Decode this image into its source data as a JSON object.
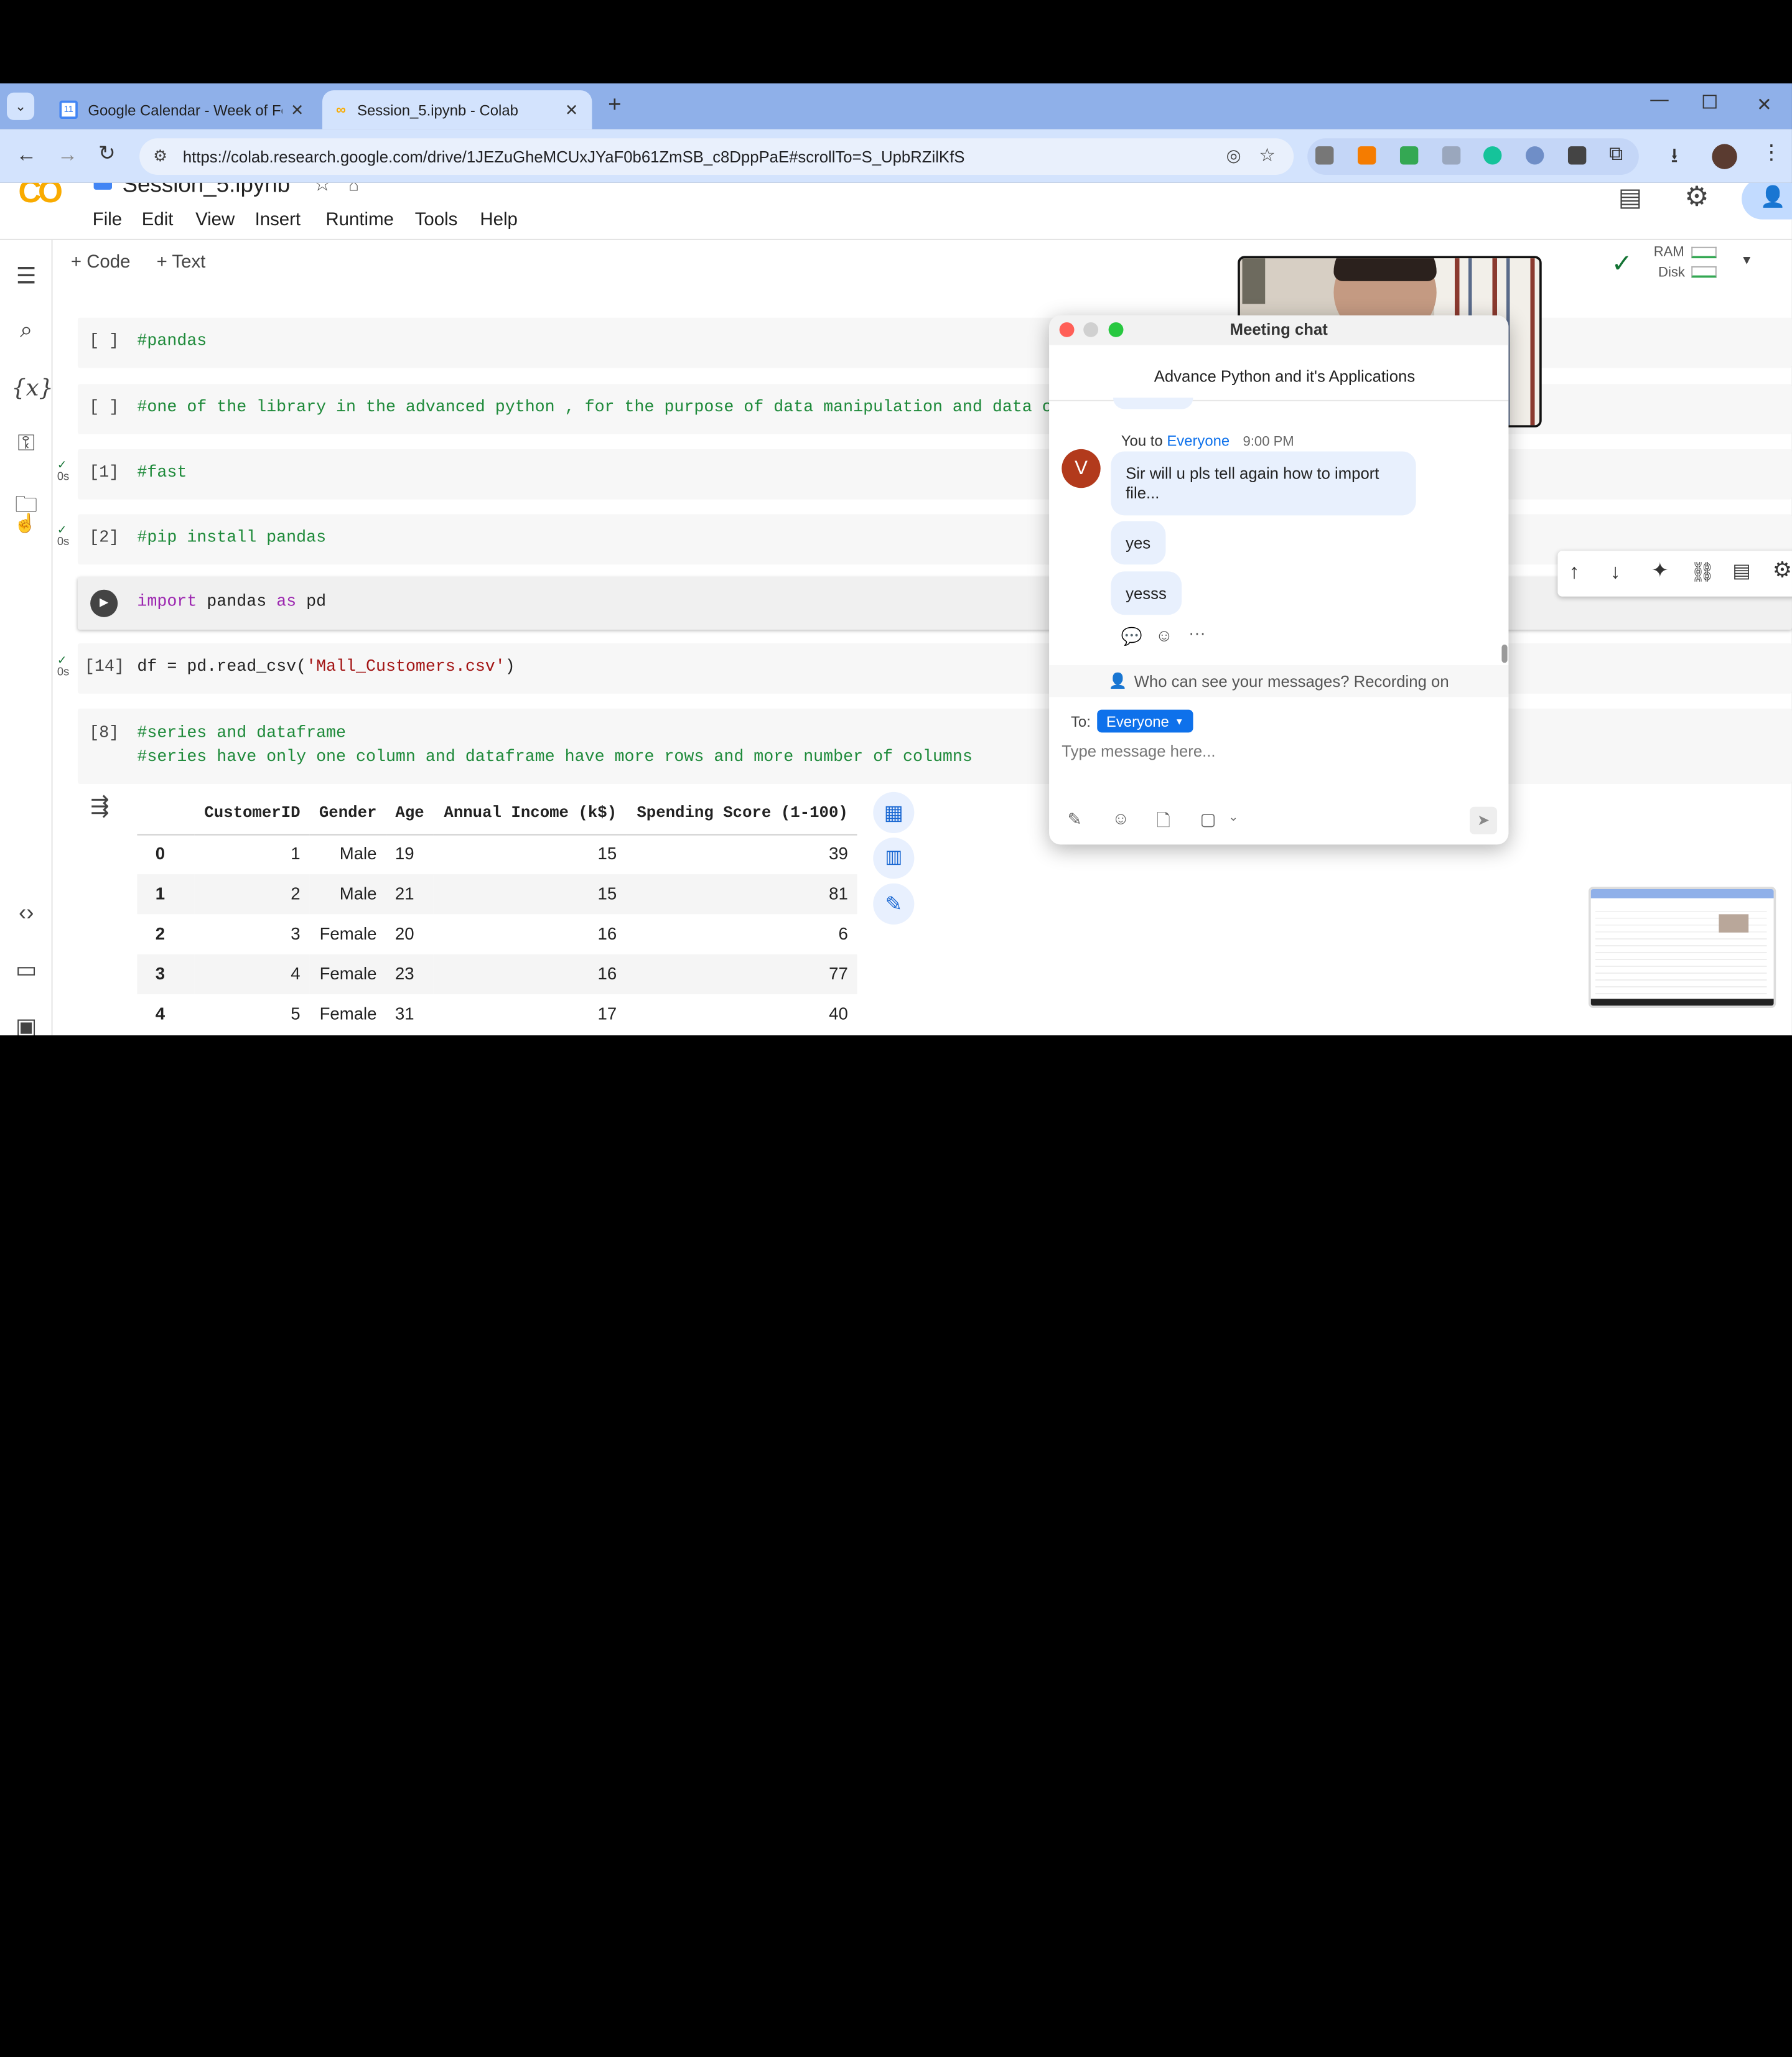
{
  "browser": {
    "tabs": [
      {
        "label": "Google Calendar - Week of Feb",
        "favicon": "calendar-icon"
      },
      {
        "label": "Session_5.ipynb - Colab",
        "favicon": "colab-icon"
      }
    ],
    "calendar_favicon_text": "11",
    "url": "https://colab.research.google.com/drive/1JEZuGheMCUxJYaF0b61ZmSB_c8DppPaE#scrollTo=S_UpbRZilKfS"
  },
  "colab": {
    "logo": "CO",
    "notebook_title": "Session_5.ipynb",
    "menu": [
      "File",
      "Edit",
      "View",
      "Insert",
      "Runtime",
      "Tools",
      "Help"
    ],
    "toolbar": {
      "code_label": "+ Code",
      "text_label": "+ Text"
    },
    "resources": {
      "ram_label": "RAM",
      "disk_label": "Disk"
    },
    "cells": [
      {
        "exec": "[ ]",
        "code": "#pandas"
      },
      {
        "exec": "[ ]",
        "code": "#one of the library in the advanced python , for the purpose of data manipulation and data cl"
      },
      {
        "exec": "[1]",
        "code": "#fast",
        "time": "0s"
      },
      {
        "exec": "[2]",
        "code": "#pip install pandas",
        "time": "0s"
      },
      {
        "exec": "",
        "code_kw1": "import",
        "code_mid": " pandas ",
        "code_kw2": "as",
        "code_end": " pd"
      },
      {
        "exec": "[14]",
        "code_pre": "df = pd.read_csv(",
        "code_str": "'Mall_Customers.csv'",
        "code_post": ")",
        "time": "0s"
      },
      {
        "exec": "[8]",
        "line1": "#series and dataframe",
        "line2": "#series have only one column and dataframe have more rows and more number of columns"
      }
    ],
    "table": {
      "columns": [
        "",
        "CustomerID",
        "Gender",
        "Age",
        "Annual Income (k$)",
        "Spending Score (1-100)"
      ],
      "rows": [
        [
          "0",
          "1",
          "Male",
          "19",
          "15",
          "39"
        ],
        [
          "1",
          "2",
          "Male",
          "21",
          "15",
          "81"
        ],
        [
          "2",
          "3",
          "Female",
          "20",
          "16",
          "6"
        ],
        [
          "3",
          "4",
          "Female",
          "23",
          "16",
          "77"
        ],
        [
          "4",
          "5",
          "Female",
          "31",
          "17",
          "40"
        ]
      ]
    }
  },
  "chat": {
    "window_title": "Meeting chat",
    "meeting_name": "Advance Python and it's Applications",
    "sender_prefix": "You to",
    "recipient": "Everyone",
    "time": "9:00 PM",
    "avatar_letter": "V",
    "messages": [
      "Sir will u pls tell again how to import file...",
      "yes",
      "yesss"
    ],
    "privacy_notice": "Who can see your messages? Recording on",
    "to_label": "To:",
    "to_value": "Everyone",
    "input_placeholder": "Type message here..."
  },
  "colors": {
    "tabbar": "#8fb0e9",
    "address": "#d3e3fd",
    "colab_orange": "#f9ab00",
    "chat_blue": "#0e71eb",
    "avatar": "#b23a1c"
  }
}
